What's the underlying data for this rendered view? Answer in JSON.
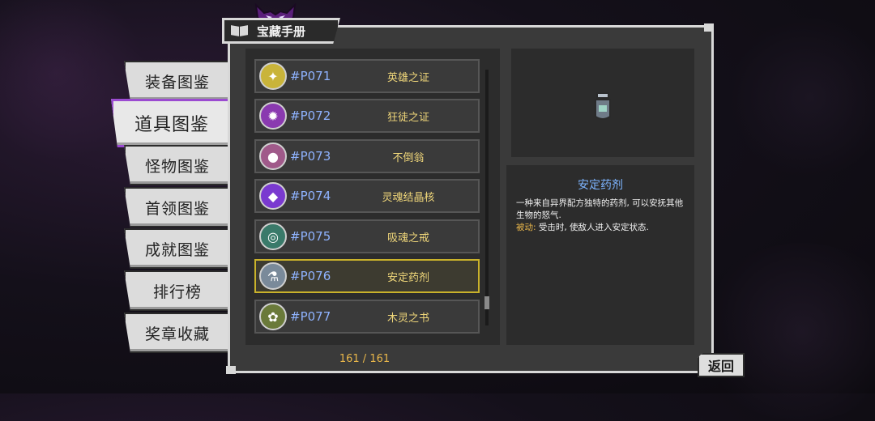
{
  "sidebar": {
    "tabs": [
      {
        "label": "装备图鉴",
        "active": false
      },
      {
        "label": "道具图鉴",
        "active": true
      },
      {
        "label": "怪物图鉴",
        "active": false
      },
      {
        "label": "首领图鉴",
        "active": false
      },
      {
        "label": "成就图鉴",
        "active": false
      },
      {
        "label": "排行榜",
        "active": false
      },
      {
        "label": "奖章收藏",
        "active": false
      }
    ]
  },
  "header": {
    "title": "宝藏手册"
  },
  "items": [
    {
      "code": "#P071",
      "name": "英雄之证",
      "icon": "hero-badge-icon",
      "color": "#c9b43a",
      "selected": false
    },
    {
      "code": "#P072",
      "name": "狂徒之证",
      "icon": "madman-badge-icon",
      "color": "#8a3ab0",
      "selected": false
    },
    {
      "code": "#P073",
      "name": "不倒翁",
      "icon": "tumbler-icon",
      "color": "#a05a8a",
      "selected": false
    },
    {
      "code": "#P074",
      "name": "灵魂结晶核",
      "icon": "soul-crystal-icon",
      "color": "#7a3ad0",
      "selected": false
    },
    {
      "code": "#P075",
      "name": "吸魂之戒",
      "icon": "soul-ring-icon",
      "color": "#3a7a6a",
      "selected": false
    },
    {
      "code": "#P076",
      "name": "安定药剂",
      "icon": "potion-icon",
      "color": "#7a8a9a",
      "selected": true
    },
    {
      "code": "#P077",
      "name": "木灵之书",
      "icon": "wood-book-icon",
      "color": "#6a7a3a",
      "selected": false
    }
  ],
  "counter": "161 / 161",
  "detail": {
    "title": "安定药剂",
    "description": "一种来自异界配方独特的药剂, 可以安抚其他生物的怒气.",
    "passive_label": "被动:",
    "passive_text": " 受击时, 使敌人进入安定状态."
  },
  "back_button": "返回"
}
